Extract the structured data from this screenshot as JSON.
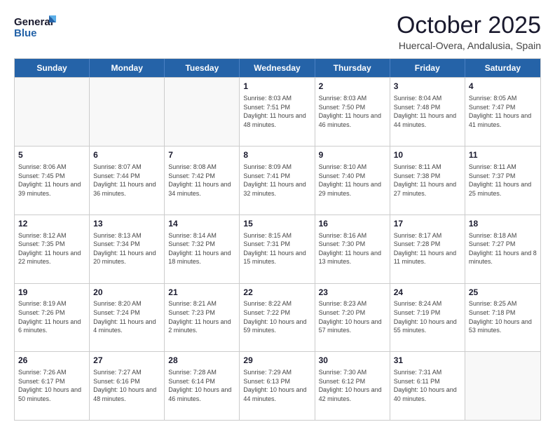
{
  "logo": {
    "line1": "General",
    "line2": "Blue"
  },
  "title": "October 2025",
  "subtitle": "Huercal-Overa, Andalusia, Spain",
  "days": [
    "Sunday",
    "Monday",
    "Tuesday",
    "Wednesday",
    "Thursday",
    "Friday",
    "Saturday"
  ],
  "weeks": [
    [
      {
        "day": "",
        "info": ""
      },
      {
        "day": "",
        "info": ""
      },
      {
        "day": "",
        "info": ""
      },
      {
        "day": "1",
        "info": "Sunrise: 8:03 AM\nSunset: 7:51 PM\nDaylight: 11 hours and 48 minutes."
      },
      {
        "day": "2",
        "info": "Sunrise: 8:03 AM\nSunset: 7:50 PM\nDaylight: 11 hours and 46 minutes."
      },
      {
        "day": "3",
        "info": "Sunrise: 8:04 AM\nSunset: 7:48 PM\nDaylight: 11 hours and 44 minutes."
      },
      {
        "day": "4",
        "info": "Sunrise: 8:05 AM\nSunset: 7:47 PM\nDaylight: 11 hours and 41 minutes."
      }
    ],
    [
      {
        "day": "5",
        "info": "Sunrise: 8:06 AM\nSunset: 7:45 PM\nDaylight: 11 hours and 39 minutes."
      },
      {
        "day": "6",
        "info": "Sunrise: 8:07 AM\nSunset: 7:44 PM\nDaylight: 11 hours and 36 minutes."
      },
      {
        "day": "7",
        "info": "Sunrise: 8:08 AM\nSunset: 7:42 PM\nDaylight: 11 hours and 34 minutes."
      },
      {
        "day": "8",
        "info": "Sunrise: 8:09 AM\nSunset: 7:41 PM\nDaylight: 11 hours and 32 minutes."
      },
      {
        "day": "9",
        "info": "Sunrise: 8:10 AM\nSunset: 7:40 PM\nDaylight: 11 hours and 29 minutes."
      },
      {
        "day": "10",
        "info": "Sunrise: 8:11 AM\nSunset: 7:38 PM\nDaylight: 11 hours and 27 minutes."
      },
      {
        "day": "11",
        "info": "Sunrise: 8:11 AM\nSunset: 7:37 PM\nDaylight: 11 hours and 25 minutes."
      }
    ],
    [
      {
        "day": "12",
        "info": "Sunrise: 8:12 AM\nSunset: 7:35 PM\nDaylight: 11 hours and 22 minutes."
      },
      {
        "day": "13",
        "info": "Sunrise: 8:13 AM\nSunset: 7:34 PM\nDaylight: 11 hours and 20 minutes."
      },
      {
        "day": "14",
        "info": "Sunrise: 8:14 AM\nSunset: 7:32 PM\nDaylight: 11 hours and 18 minutes."
      },
      {
        "day": "15",
        "info": "Sunrise: 8:15 AM\nSunset: 7:31 PM\nDaylight: 11 hours and 15 minutes."
      },
      {
        "day": "16",
        "info": "Sunrise: 8:16 AM\nSunset: 7:30 PM\nDaylight: 11 hours and 13 minutes."
      },
      {
        "day": "17",
        "info": "Sunrise: 8:17 AM\nSunset: 7:28 PM\nDaylight: 11 hours and 11 minutes."
      },
      {
        "day": "18",
        "info": "Sunrise: 8:18 AM\nSunset: 7:27 PM\nDaylight: 11 hours and 8 minutes."
      }
    ],
    [
      {
        "day": "19",
        "info": "Sunrise: 8:19 AM\nSunset: 7:26 PM\nDaylight: 11 hours and 6 minutes."
      },
      {
        "day": "20",
        "info": "Sunrise: 8:20 AM\nSunset: 7:24 PM\nDaylight: 11 hours and 4 minutes."
      },
      {
        "day": "21",
        "info": "Sunrise: 8:21 AM\nSunset: 7:23 PM\nDaylight: 11 hours and 2 minutes."
      },
      {
        "day": "22",
        "info": "Sunrise: 8:22 AM\nSunset: 7:22 PM\nDaylight: 10 hours and 59 minutes."
      },
      {
        "day": "23",
        "info": "Sunrise: 8:23 AM\nSunset: 7:20 PM\nDaylight: 10 hours and 57 minutes."
      },
      {
        "day": "24",
        "info": "Sunrise: 8:24 AM\nSunset: 7:19 PM\nDaylight: 10 hours and 55 minutes."
      },
      {
        "day": "25",
        "info": "Sunrise: 8:25 AM\nSunset: 7:18 PM\nDaylight: 10 hours and 53 minutes."
      }
    ],
    [
      {
        "day": "26",
        "info": "Sunrise: 7:26 AM\nSunset: 6:17 PM\nDaylight: 10 hours and 50 minutes."
      },
      {
        "day": "27",
        "info": "Sunrise: 7:27 AM\nSunset: 6:16 PM\nDaylight: 10 hours and 48 minutes."
      },
      {
        "day": "28",
        "info": "Sunrise: 7:28 AM\nSunset: 6:14 PM\nDaylight: 10 hours and 46 minutes."
      },
      {
        "day": "29",
        "info": "Sunrise: 7:29 AM\nSunset: 6:13 PM\nDaylight: 10 hours and 44 minutes."
      },
      {
        "day": "30",
        "info": "Sunrise: 7:30 AM\nSunset: 6:12 PM\nDaylight: 10 hours and 42 minutes."
      },
      {
        "day": "31",
        "info": "Sunrise: 7:31 AM\nSunset: 6:11 PM\nDaylight: 10 hours and 40 minutes."
      },
      {
        "day": "",
        "info": ""
      }
    ]
  ]
}
